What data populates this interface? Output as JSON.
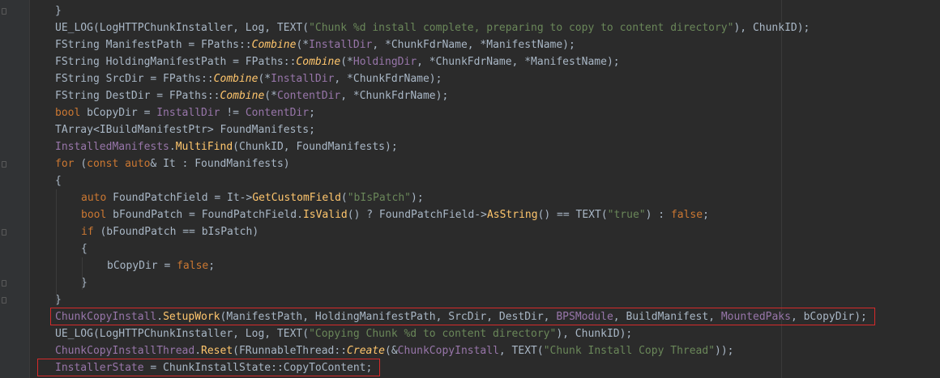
{
  "accent_colors": {
    "keyword": "#cc7832",
    "string": "#6a8759",
    "member": "#9876aa",
    "function": "#ffc66d",
    "identifier": "#a9b7c6",
    "highlight_box": "#d62a2a"
  },
  "lines": [
    {
      "indent": 0,
      "tokens": [
        {
          "t": "}",
          "c": "id"
        }
      ]
    },
    {
      "indent": 0,
      "tokens": [
        {
          "t": "UE_LOG(LogHTTPChunkInstaller, Log, TEXT(",
          "c": "id"
        },
        {
          "t": "\"Chunk %d install complete, preparing to copy to content directory\"",
          "c": "str"
        },
        {
          "t": "), ChunkID);",
          "c": "id"
        }
      ]
    },
    {
      "indent": 0,
      "tokens": [
        {
          "t": "FString ManifestPath = FPaths::",
          "c": "id"
        },
        {
          "t": "Combine",
          "c": "fni"
        },
        {
          "t": "(*",
          "c": "id"
        },
        {
          "t": "InstallDir",
          "c": "mem"
        },
        {
          "t": ", *ChunkFdrName, *ManifestName);",
          "c": "id"
        }
      ]
    },
    {
      "indent": 0,
      "tokens": [
        {
          "t": "FString HoldingManifestPath = FPaths::",
          "c": "id"
        },
        {
          "t": "Combine",
          "c": "fni"
        },
        {
          "t": "(*",
          "c": "id"
        },
        {
          "t": "HoldingDir",
          "c": "mem"
        },
        {
          "t": ", *ChunkFdrName, *ManifestName);",
          "c": "id"
        }
      ]
    },
    {
      "indent": 0,
      "tokens": [
        {
          "t": "FString SrcDir = FPaths::",
          "c": "id"
        },
        {
          "t": "Combine",
          "c": "fni"
        },
        {
          "t": "(*",
          "c": "id"
        },
        {
          "t": "InstallDir",
          "c": "mem"
        },
        {
          "t": ", *ChunkFdrName);",
          "c": "id"
        }
      ]
    },
    {
      "indent": 0,
      "tokens": [
        {
          "t": "FString DestDir = FPaths::",
          "c": "id"
        },
        {
          "t": "Combine",
          "c": "fni"
        },
        {
          "t": "(*",
          "c": "id"
        },
        {
          "t": "ContentDir",
          "c": "mem"
        },
        {
          "t": ", *ChunkFdrName);",
          "c": "id"
        }
      ]
    },
    {
      "indent": 0,
      "tokens": [
        {
          "t": "bool ",
          "c": "kw"
        },
        {
          "t": "bCopyDir = ",
          "c": "id"
        },
        {
          "t": "InstallDir",
          "c": "mem"
        },
        {
          "t": " != ",
          "c": "id"
        },
        {
          "t": "ContentDir",
          "c": "mem"
        },
        {
          "t": ";",
          "c": "id"
        }
      ]
    },
    {
      "indent": 0,
      "tokens": [
        {
          "t": "TArray<IBuildManifestPtr> FoundManifests;",
          "c": "id"
        }
      ]
    },
    {
      "indent": 0,
      "tokens": [
        {
          "t": "InstalledManifests",
          "c": "mem"
        },
        {
          "t": ".",
          "c": "id"
        },
        {
          "t": "MultiFind",
          "c": "fn"
        },
        {
          "t": "(ChunkID, FoundManifests);",
          "c": "id"
        }
      ]
    },
    {
      "indent": 0,
      "tokens": [
        {
          "t": "for ",
          "c": "kw"
        },
        {
          "t": "(",
          "c": "id"
        },
        {
          "t": "const auto",
          "c": "kw"
        },
        {
          "t": "& It : FoundManifests)",
          "c": "id"
        }
      ]
    },
    {
      "indent": 0,
      "tokens": [
        {
          "t": "{",
          "c": "id"
        }
      ]
    },
    {
      "indent": 1,
      "tokens": [
        {
          "t": "auto ",
          "c": "kw"
        },
        {
          "t": "FoundPatchField = It->",
          "c": "id"
        },
        {
          "t": "GetCustomField",
          "c": "fn"
        },
        {
          "t": "(",
          "c": "id"
        },
        {
          "t": "\"bIsPatch\"",
          "c": "str"
        },
        {
          "t": ");",
          "c": "id"
        }
      ]
    },
    {
      "indent": 1,
      "tokens": [
        {
          "t": "bool ",
          "c": "kw"
        },
        {
          "t": "bFoundPatch = FoundPatchField.",
          "c": "id"
        },
        {
          "t": "IsValid",
          "c": "fn"
        },
        {
          "t": "() ? FoundPatchField->",
          "c": "id"
        },
        {
          "t": "AsString",
          "c": "fn"
        },
        {
          "t": "() == TEXT(",
          "c": "id"
        },
        {
          "t": "\"true\"",
          "c": "str"
        },
        {
          "t": ") : ",
          "c": "id"
        },
        {
          "t": "false",
          "c": "kw"
        },
        {
          "t": ";",
          "c": "id"
        }
      ]
    },
    {
      "indent": 1,
      "tokens": [
        {
          "t": "if ",
          "c": "kw"
        },
        {
          "t": "(bFoundPatch == bIsPatch)",
          "c": "id"
        }
      ]
    },
    {
      "indent": 1,
      "tokens": [
        {
          "t": "{",
          "c": "id"
        }
      ]
    },
    {
      "indent": 2,
      "tokens": [
        {
          "t": "bCopyDir = ",
          "c": "id"
        },
        {
          "t": "false",
          "c": "kw"
        },
        {
          "t": ";",
          "c": "id"
        }
      ]
    },
    {
      "indent": 1,
      "tokens": [
        {
          "t": "}",
          "c": "id"
        }
      ]
    },
    {
      "indent": 0,
      "tokens": [
        {
          "t": "}",
          "c": "id"
        }
      ]
    },
    {
      "indent": 0,
      "tokens": [
        {
          "t": "ChunkCopyInstall",
          "c": "mem"
        },
        {
          "t": ".",
          "c": "id"
        },
        {
          "t": "SetupWork",
          "c": "fn"
        },
        {
          "t": "(ManifestPath, HoldingManifestPath, SrcDir, DestDir, ",
          "c": "id"
        },
        {
          "t": "BPSModule",
          "c": "mem"
        },
        {
          "t": ", BuildManifest, ",
          "c": "id"
        },
        {
          "t": "MountedPaks",
          "c": "mem"
        },
        {
          "t": ", bCopyDir);",
          "c": "id"
        }
      ]
    },
    {
      "indent": 0,
      "tokens": [
        {
          "t": "UE_LOG(LogHTTPChunkInstaller, Log, TEXT(",
          "c": "id"
        },
        {
          "t": "\"Copying Chunk %d to content directory\"",
          "c": "str"
        },
        {
          "t": "), ChunkID);",
          "c": "id"
        }
      ]
    },
    {
      "indent": 0,
      "tokens": [
        {
          "t": "ChunkCopyInstallThread",
          "c": "mem"
        },
        {
          "t": ".",
          "c": "id"
        },
        {
          "t": "Reset",
          "c": "fn"
        },
        {
          "t": "(FRunnableThread::",
          "c": "id"
        },
        {
          "t": "Create",
          "c": "fni"
        },
        {
          "t": "(&",
          "c": "id"
        },
        {
          "t": "ChunkCopyInstall",
          "c": "mem"
        },
        {
          "t": ", TEXT(",
          "c": "id"
        },
        {
          "t": "\"Chunk Install Copy Thread\"",
          "c": "str"
        },
        {
          "t": "));",
          "c": "id"
        }
      ]
    },
    {
      "indent": 0,
      "tokens": [
        {
          "t": "InstallerState",
          "c": "mem"
        },
        {
          "t": " = ChunkInstallState::CopyToContent;",
          "c": "id"
        }
      ]
    }
  ],
  "highlighted_lines": [
    18,
    21
  ]
}
